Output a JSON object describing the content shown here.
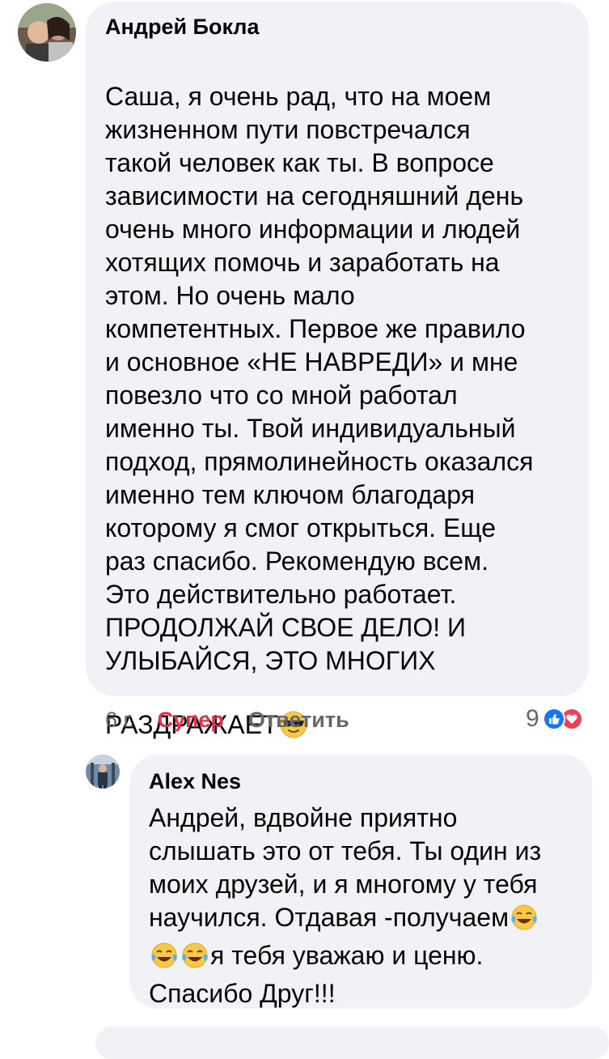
{
  "comments": [
    {
      "author": "Андрей Бокла",
      "text": "Саша, я очень рад, что на моем\nжизненном пути повстречался\nтакой человек как ты. В вопросе\nзависимости на сегодняшний день\nочень много информации и людей\nхотящих помочь и заработать на\nэтом. Но очень мало\nкомпетентных. Первое же правило\nи основное «НЕ НАВРЕДИ» и мне\nповезло что со мной работал\nименно ты. Твой индивидуальный\nподход, прямолинейность оказался\nименно тем ключом благодаря\nкоторому я смог открыться. Еще\nраз спасибо. Рекомендую всем.\nЭто действительно работает.\nПРОДОЛЖАЙ СВОЕ ДЕЛО! И\nУЛЫБАЙСЯ, ЭТО МНОГИХ\nРАЗДРАЖАЕТ",
      "emoji_end": "sunglasses-emoji",
      "time": "6 г.",
      "reaction_label": "Супер",
      "reply_label": "Ответить",
      "reaction_count": "9",
      "reaction_icons": [
        "like-icon",
        "love-icon"
      ],
      "reaction_color": "#e4304a"
    },
    {
      "author": "Alex Nes",
      "text_line1": "Андрей, вдвойне приятно",
      "text_line2": "слышать это от тебя. Ты один из",
      "text_line3": "моих друзей, и я многому у тебя",
      "text_line4": "научился. Отдавая -получаем",
      "text_line5": "я тебя уважаю и ценю.",
      "text_line6": "Спасибо Друг!!!",
      "emoji": "tears-of-joy-emoji"
    }
  ],
  "colors": {
    "bubble_bg": "#f0f2f5",
    "meta_text": "#65676b",
    "like_blue": "#1877f2",
    "love_red": "#f33e58"
  }
}
